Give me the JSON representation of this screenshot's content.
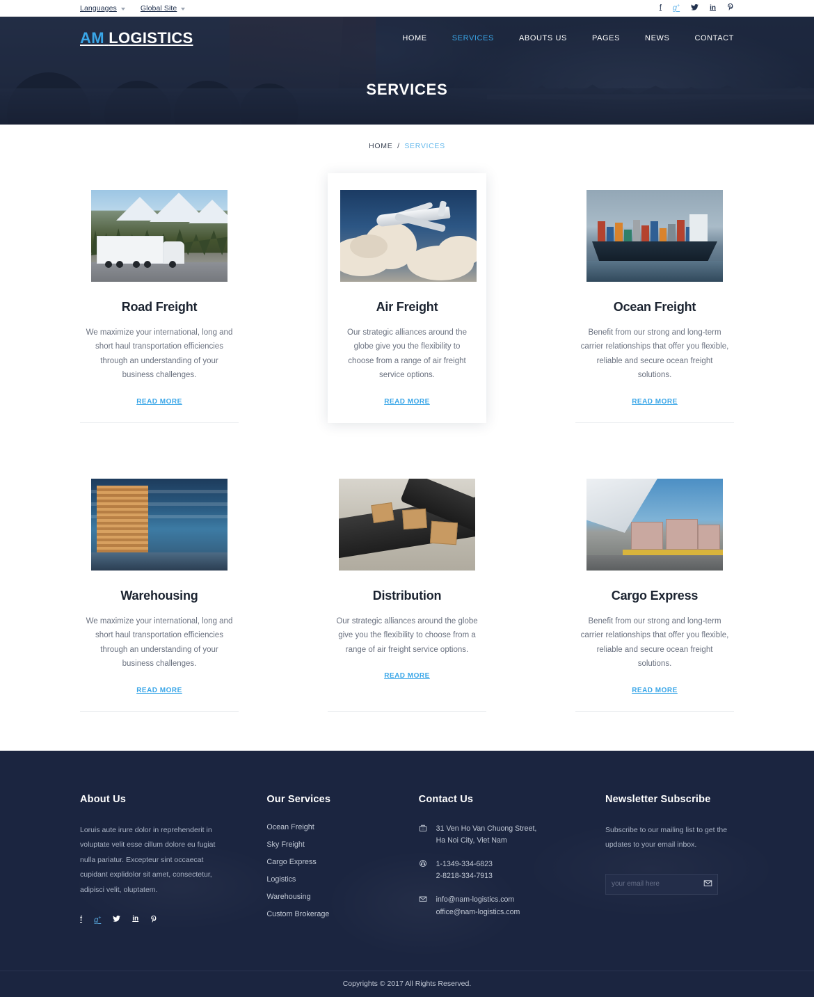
{
  "topbar": {
    "languages_label": "Languages",
    "global_site_label": "Global Site",
    "social": [
      {
        "name": "facebook-icon",
        "glyph": "f"
      },
      {
        "name": "google-plus-icon",
        "glyph": "g"
      },
      {
        "name": "twitter-icon",
        "glyph": "ᵤ"
      },
      {
        "name": "linkedin-icon",
        "glyph": "in"
      },
      {
        "name": "pinterest-icon",
        "glyph": "℗"
      }
    ]
  },
  "header": {
    "logo_prefix": "AM",
    "logo_suffix": "LOGISTICS",
    "nav": [
      {
        "label": "HOME",
        "active": false
      },
      {
        "label": "SERVICES",
        "active": true
      },
      {
        "label": "ABOUTS US",
        "active": false
      },
      {
        "label": "PAGES",
        "active": false
      },
      {
        "label": "NEWS",
        "active": false
      },
      {
        "label": "CONTACT",
        "active": false
      }
    ],
    "page_title": "SERVICES"
  },
  "breadcrumb": {
    "home": "HOME",
    "separator": "/",
    "current": "SERVICES"
  },
  "services": {
    "read_more_label": "READ MORE",
    "rows": [
      [
        {
          "title": "Road Freight",
          "text": "We maximize your international, long and short haul transportation efficiencies through an understanding of your business challenges.",
          "image": "truck-mountain-highway-image",
          "raised": false
        },
        {
          "title": "Air Freight",
          "text": "Our strategic alliances around the globe give you the flexibility to choose from a range of air freight service options.",
          "image": "airplane-clouds-image",
          "raised": true
        },
        {
          "title": "Ocean Freight",
          "text": "Benefit from our strong and long-term carrier relationships that offer you flexible, reliable and secure ocean freight solutions.",
          "image": "container-ship-image",
          "raised": false
        }
      ],
      [
        {
          "title": "Warehousing",
          "text": "We maximize your international, long and short haul transportation efficiencies through an understanding of your business challenges.",
          "image": "warehouse-interior-image",
          "raised": false
        },
        {
          "title": "Distribution",
          "text": "Our strategic alliances around the globe give you the flexibility to choose from a range of air freight service options.",
          "image": "conveyor-belt-boxes-image",
          "raised": false
        },
        {
          "title": "Cargo Express",
          "text": "Benefit from our strong and long-term carrier relationships that offer you flexible, reliable and secure ocean freight solutions.",
          "image": "air-cargo-pallets-image",
          "raised": false
        }
      ]
    ]
  },
  "footer": {
    "about": {
      "title": "About Us",
      "text": "Loruis aute irure dolor in reprehenderit in voluptate velit esse cillum dolore eu fugiat nulla pariatur. Excepteur sint occaecat cupidant explidolor sit amet, consectetur, adipisci velit, oluptatem.",
      "social": [
        {
          "name": "facebook-icon",
          "glyph": "f"
        },
        {
          "name": "google-plus-icon",
          "glyph": "g"
        },
        {
          "name": "twitter-icon",
          "glyph": "ᵤ"
        },
        {
          "name": "linkedin-icon",
          "glyph": "in"
        },
        {
          "name": "pinterest-icon",
          "glyph": "℗"
        }
      ]
    },
    "our_services": {
      "title": "Our Services",
      "links": [
        "Ocean Freight",
        "Sky Freight",
        "Cargo Express",
        "Logistics",
        "Warehousing",
        "Custom Brokerage"
      ]
    },
    "contact": {
      "title": "Contact Us",
      "address_line1": "31 Ven Ho Van Chuong Street,",
      "address_line2": "Ha Noi City, Viet Nam",
      "phone_line1": "1-1349-334-6823",
      "phone_line2": "2-8218-334-7913",
      "email_line1": "info@nam-logistics.com",
      "email_line2": "office@nam-logistics.com"
    },
    "newsletter": {
      "title": "Newsletter Subscribe",
      "text": "Subscribe to our mailing list to get the updates to your email inbox.",
      "placeholder": "your email here",
      "value": ""
    },
    "copyright": "Copyrights © 2017 All Rights Reserved."
  },
  "colors": {
    "accent": "#3aa6e8",
    "dark": "#1b2540",
    "hero": "#222e45",
    "body_text": "#6b7280"
  }
}
